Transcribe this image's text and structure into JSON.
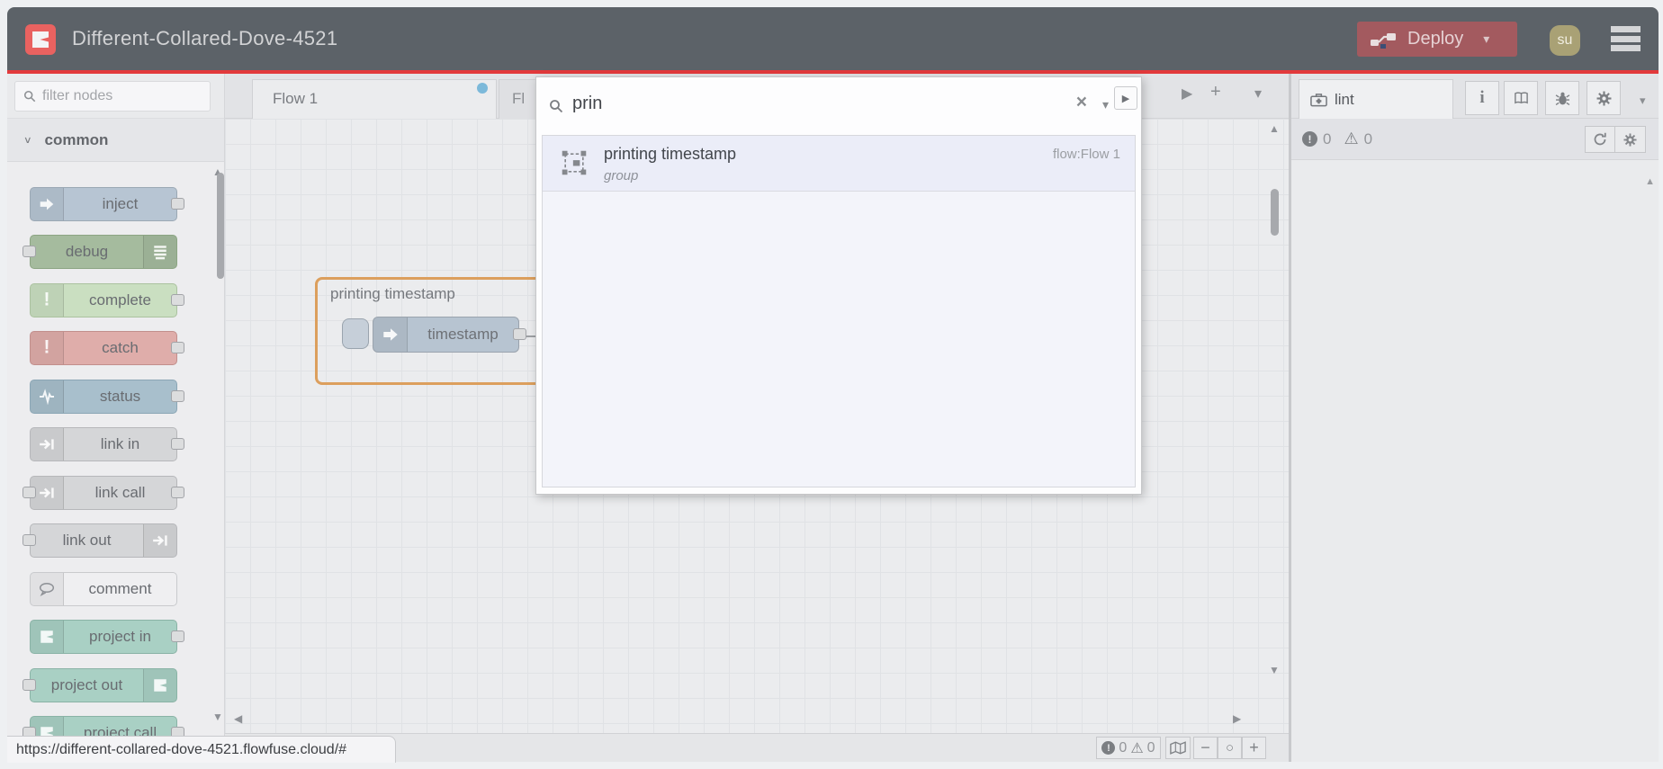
{
  "header": {
    "title": "Different-Collared-Dove-4521",
    "deploy_label": "Deploy",
    "avatar_initials": "su",
    "bg": "#5c6268",
    "accent_red": "#e23a3c",
    "logo_red": "#e96260",
    "deploy_bg": "#a35a5f"
  },
  "palette": {
    "filter_placeholder": "filter nodes",
    "category": "common",
    "nodes": [
      {
        "label": "inject",
        "bg": "#b7c5d3",
        "border": "#9ba8b4",
        "icon": "inject-arrow",
        "icon_side": "left",
        "ports": "right"
      },
      {
        "label": "debug",
        "bg": "#a5bb9e",
        "border": "#8ca583",
        "icon": "debug-list",
        "icon_side": "right",
        "ports": "left"
      },
      {
        "label": "complete",
        "bg": "#cadfc1",
        "border": "#abc29f",
        "icon": "exclaim",
        "icon_side": "left",
        "ports": "right"
      },
      {
        "label": "catch",
        "bg": "#dfadaa",
        "border": "#c28f8c",
        "icon": "exclaim",
        "icon_side": "left",
        "ports": "right"
      },
      {
        "label": "status",
        "bg": "#a8bfcc",
        "border": "#8ba6b5",
        "icon": "pulse",
        "icon_side": "left",
        "ports": "right"
      },
      {
        "label": "link in",
        "bg": "#d5d6d8",
        "border": "#b6b7ba",
        "icon": "link-arrow",
        "icon_side": "left",
        "ports": "right"
      },
      {
        "label": "link call",
        "bg": "#d5d6d8",
        "border": "#b6b7ba",
        "icon": "link-arrow",
        "icon_side": "left",
        "ports": "both"
      },
      {
        "label": "link out",
        "bg": "#d5d6d8",
        "border": "#b6b7ba",
        "icon": "link-arrow",
        "icon_side": "right",
        "ports": "left"
      },
      {
        "label": "comment",
        "bg": "#efeff1",
        "border": "#c9cacd",
        "icon": "comment-bubble",
        "icon_side": "left",
        "ports": "none"
      },
      {
        "label": "project in",
        "bg": "#a9d0c4",
        "border": "#8ab3a6",
        "icon": "flowfuse-mark",
        "icon_side": "left",
        "ports": "right"
      },
      {
        "label": "project out",
        "bg": "#a9d0c4",
        "border": "#8ab3a6",
        "icon": "flowfuse-mark",
        "icon_side": "right",
        "ports": "left"
      },
      {
        "label": "project call",
        "bg": "#a9d0c4",
        "border": "#8ab3a6",
        "icon": "flowfuse-mark",
        "icon_side": "left",
        "ports": "both"
      }
    ]
  },
  "canvas": {
    "tab1_label": "Flow 1",
    "tab2_label_visible": "Fl",
    "group_label": "printing timestamp",
    "node_label": "timestamp",
    "footer": {
      "errors": "0",
      "warnings": "0"
    }
  },
  "search": {
    "query": "prin",
    "results": [
      {
        "title": "printing timestamp",
        "subtitle": "group",
        "location": "flow:Flow 1"
      }
    ]
  },
  "sidebar": {
    "tab_label": "lint",
    "errors": "0",
    "warnings": "0"
  },
  "statusbar": {
    "url": "https://different-collared-dove-4521.flowfuse.cloud/#"
  },
  "glyphs": {
    "caret_down": "▾",
    "chevron_down": "∨",
    "play": "▶",
    "plus": "+",
    "clear": "×",
    "up": "▲",
    "down": "▼",
    "left": "◀",
    "right": "▶",
    "minus": "−",
    "circle": "○",
    "warning": "⚠",
    "exclaim": "!",
    "info": "i"
  }
}
